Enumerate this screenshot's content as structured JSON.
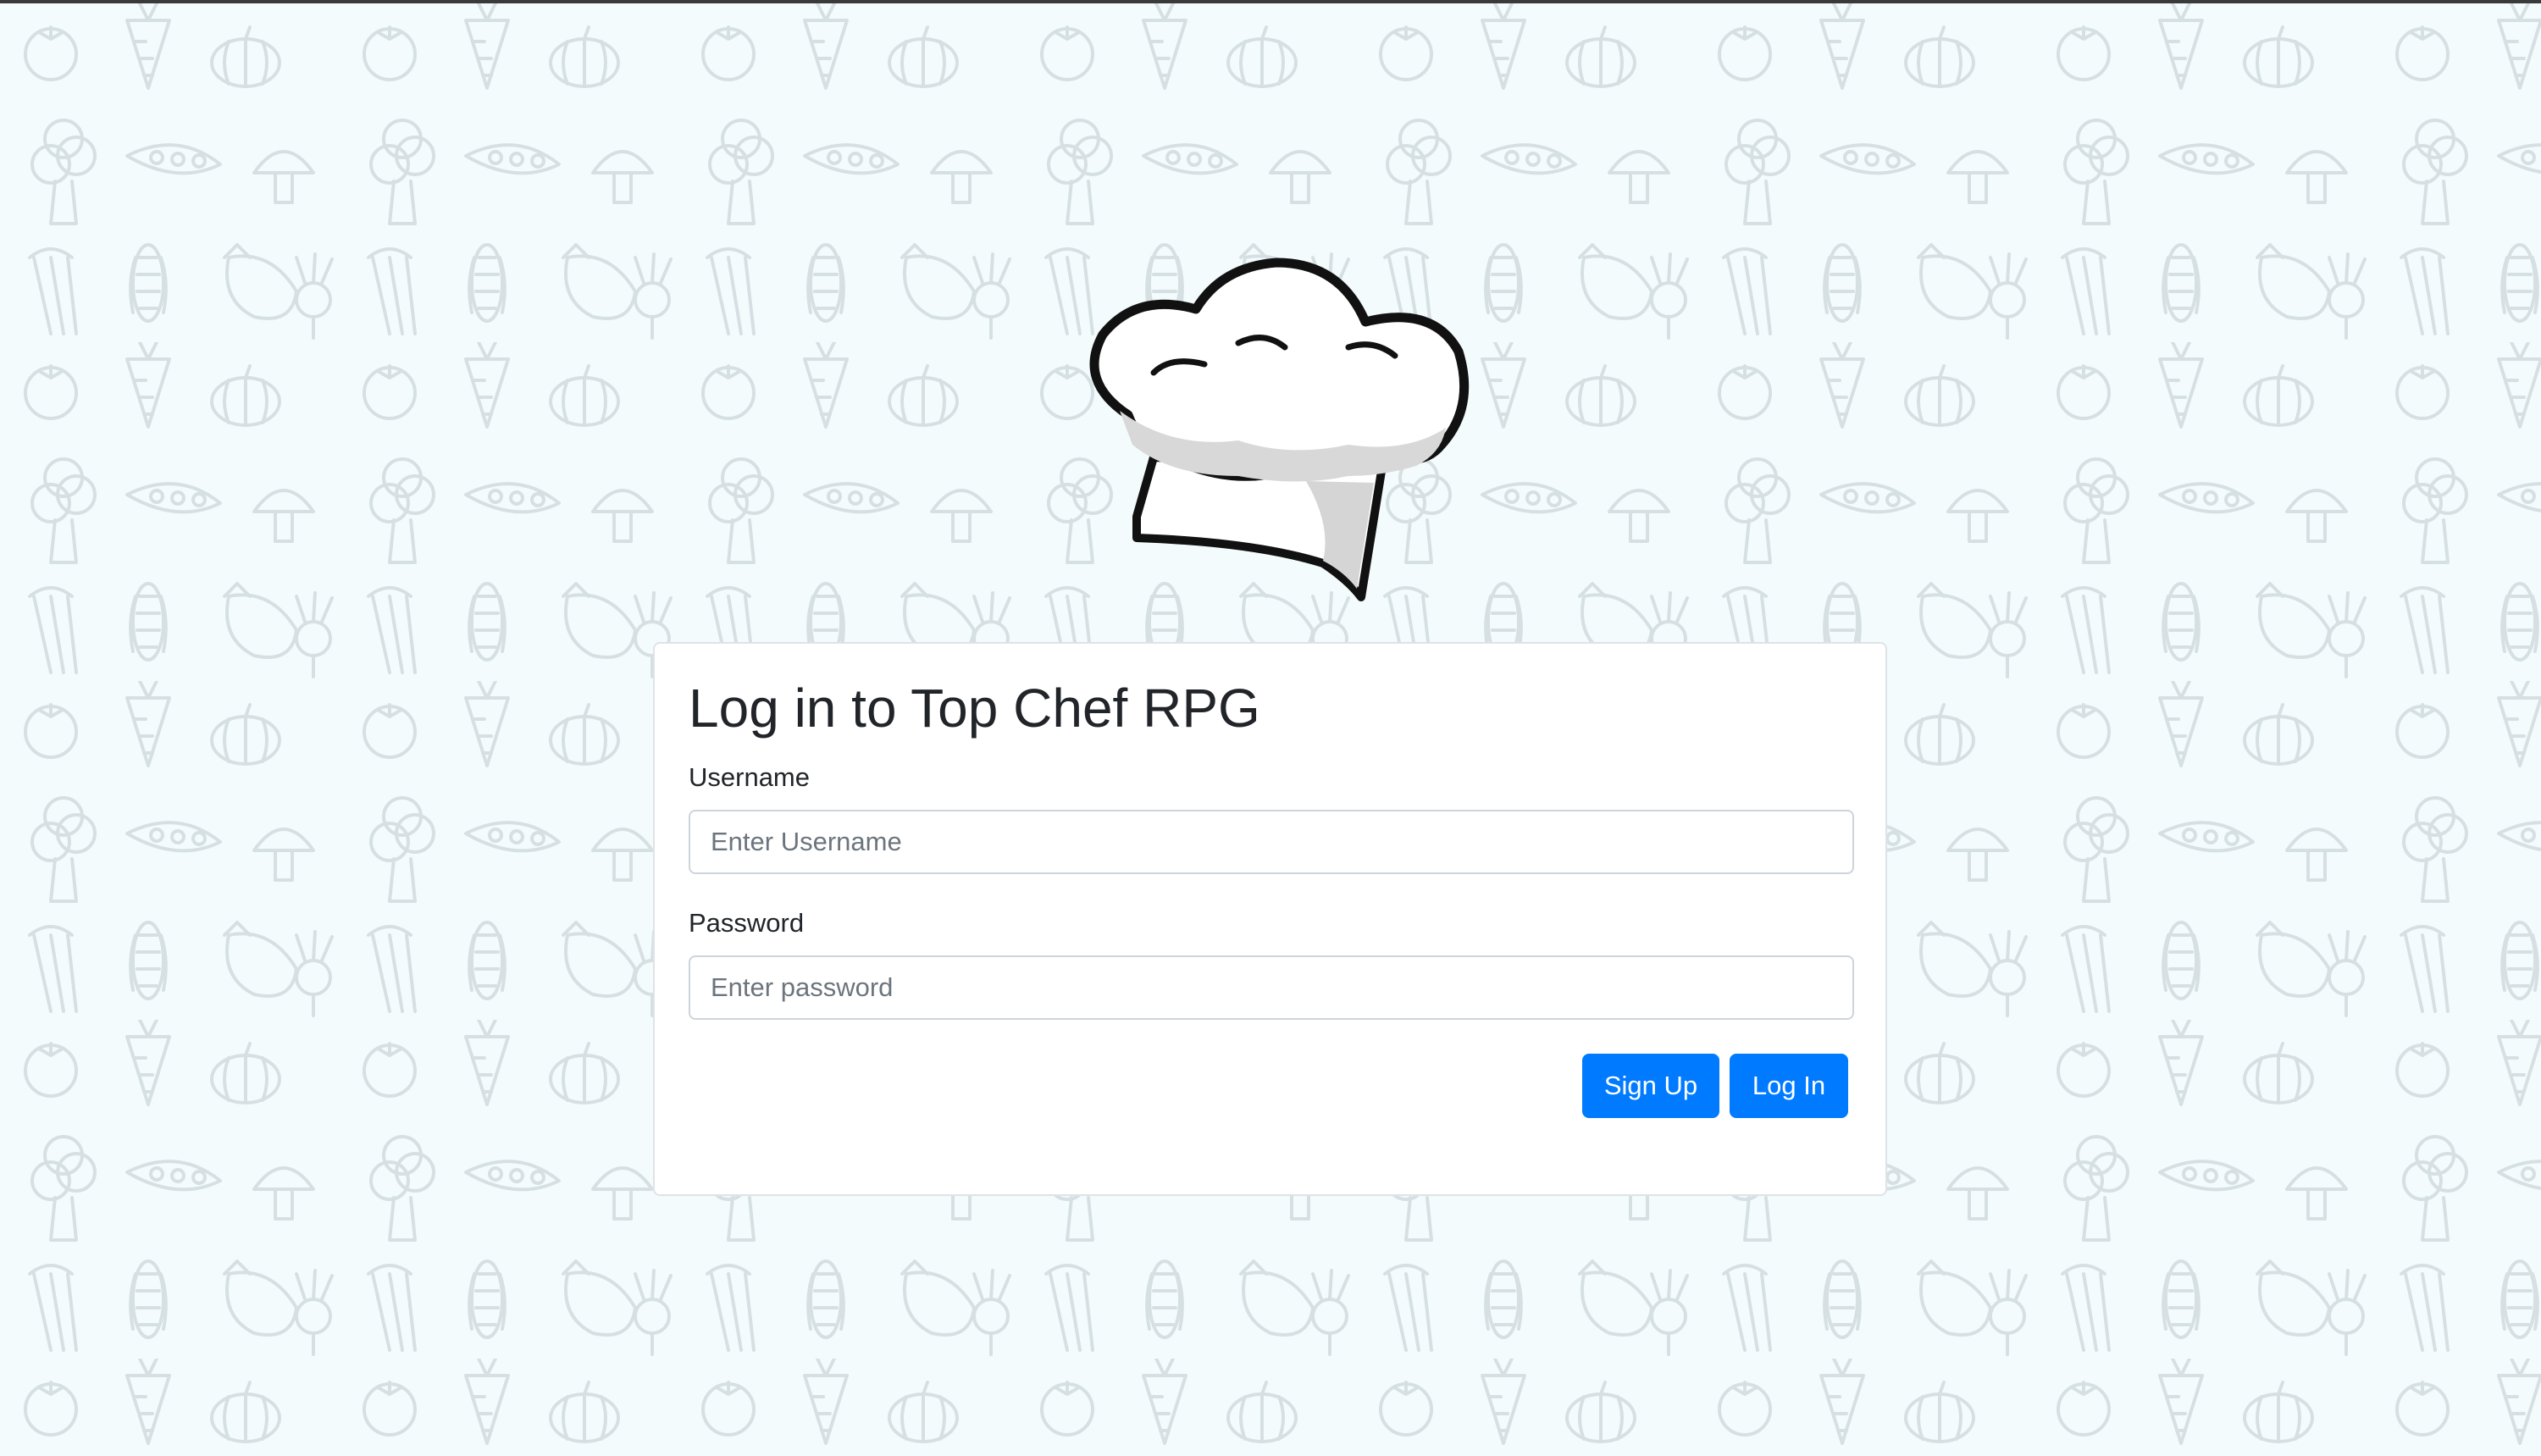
{
  "app": {
    "title": "Log in to Top Chef RPG"
  },
  "login_form": {
    "username_label": "Username",
    "username_placeholder": "Enter Username",
    "username_value": "",
    "password_label": "Password",
    "password_placeholder": "Enter password",
    "password_value": "",
    "signup_label": "Sign Up",
    "login_label": "Log In"
  },
  "icons": {
    "logo": "chef-hat-icon",
    "background": "vegetable-doodle-pattern"
  },
  "colors": {
    "page_background": "#f3fbfd",
    "pattern_stroke": "#d6e0e3",
    "primary_button": "#007bff",
    "card_border": "#dfe3e6",
    "text": "#212529"
  }
}
